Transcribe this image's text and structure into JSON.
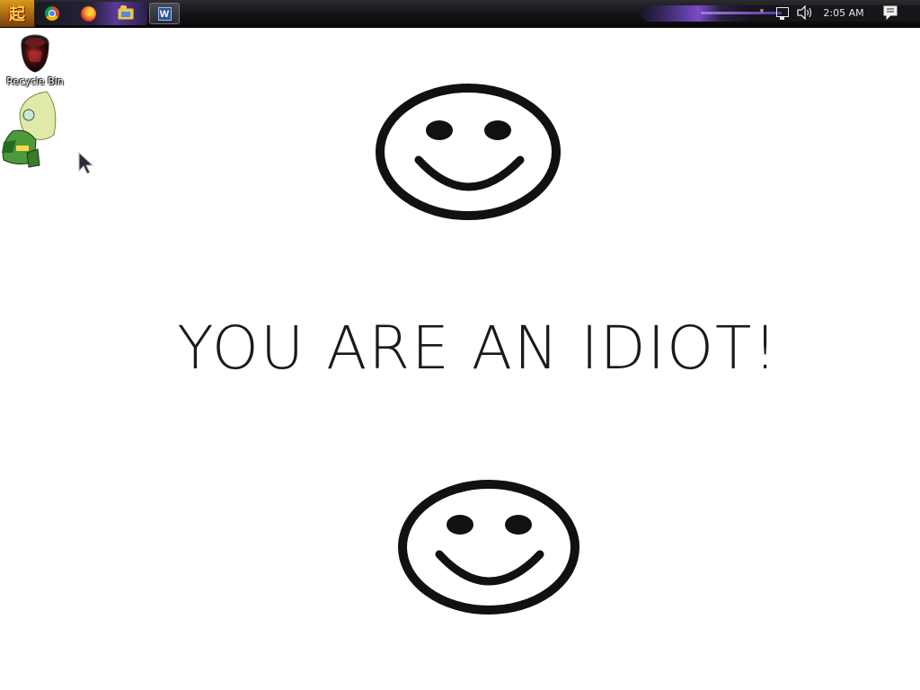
{
  "taskbar": {
    "start_glyph": "起",
    "quick_launch": [
      {
        "name": "chrome-icon"
      },
      {
        "name": "firefox-icon"
      },
      {
        "name": "file-explorer-icon"
      }
    ],
    "open_task": {
      "icon": "word-icon",
      "glyph": "W"
    },
    "tray": {
      "expand_glyph": "▼",
      "clock": "2:05 AM"
    },
    "accent_color": "#7a4ac8"
  },
  "desktop": {
    "icons": [
      {
        "label": "Recycle Bin",
        "icon": "recycle-bin-icon"
      },
      {
        "label": "",
        "icon": "peridot-character-icon"
      }
    ]
  },
  "popup": {
    "message": "YOU ARE AN IDIOT!",
    "background": "#ffffff",
    "text_color": "#1a1a1a"
  }
}
